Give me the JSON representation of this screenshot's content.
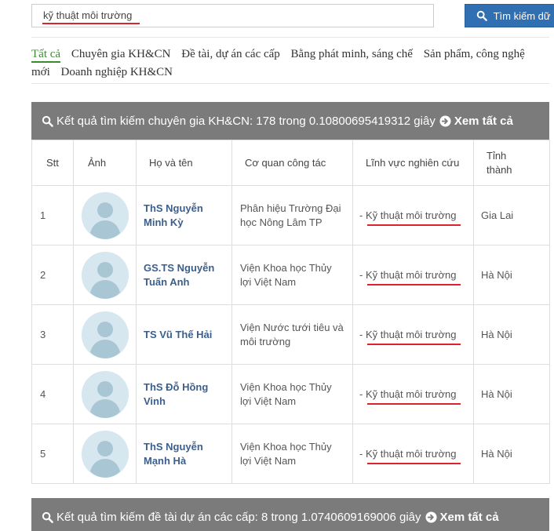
{
  "search": {
    "value": "kỹ thuật môi trường",
    "button_label": "Tìm kiếm dữ liệu"
  },
  "tabs": [
    {
      "label": "Tất cả"
    },
    {
      "label": "Chuyên gia KH&CN"
    },
    {
      "label": "Đề tài, dự án các cấp"
    },
    {
      "label": "Bằng phát minh, sáng chế"
    },
    {
      "label": "Sản phẩm, công nghệ mới"
    },
    {
      "label": "Doanh nghiệp KH&CN"
    }
  ],
  "experts_panel": {
    "summary": "Kết quả tìm kiếm chuyên gia KH&CN: 178 trong 0.10800695419312 giây",
    "see_all": "Xem tất cả",
    "columns": [
      "Stt",
      "Ảnh",
      "Họ và tên",
      "Cơ quan công tác",
      "Lĩnh vực nghiên cứu",
      "Tỉnh thành"
    ],
    "rows": [
      {
        "stt": "1",
        "name": "ThS Nguyễn Minh Kỳ",
        "org": "Phân hiệu Trường Đại học Nông Lâm TP",
        "field_prefix": "- ",
        "field": "Kỹ thuật môi trường",
        "province": "Gia Lai"
      },
      {
        "stt": "2",
        "name": "GS.TS Nguyễn Tuấn Anh",
        "org": "Viện Khoa học Thủy lợi Việt Nam",
        "field_prefix": "- ",
        "field": "Kỹ thuật môi trường",
        "province": "Hà Nội"
      },
      {
        "stt": "3",
        "name": "TS Vũ Thế Hải",
        "org": "Viện Nước tưới tiêu và môi trường",
        "field_prefix": "- ",
        "field": "Kỹ thuật môi trường",
        "province": "Hà Nội"
      },
      {
        "stt": "4",
        "name": "ThS Đỗ Hồng Vinh",
        "org": "Viện Khoa học Thủy lợi Việt Nam",
        "field_prefix": "- ",
        "field": "Kỹ thuật môi trường",
        "province": "Hà Nội"
      },
      {
        "stt": "5",
        "name": "ThS Nguyễn Mạnh Hà",
        "org": "Viện Khoa học Thủy lợi Việt Nam",
        "field_prefix": "- ",
        "field": "Kỹ thuật môi trường",
        "province": "Hà Nội"
      }
    ]
  },
  "projects_panel": {
    "summary": "Kết quả tìm kiếm đề tài dự án các cấp: 8 trong 1.0740609169006 giây",
    "see_all": "Xem tất cả"
  },
  "colors": {
    "search_button": "#2f6fb2",
    "panel_header": "#7b7b7b",
    "active_tab": "#3a8a2e",
    "name_link": "#3a5f8f",
    "annotation_underline": "#d9232d"
  }
}
